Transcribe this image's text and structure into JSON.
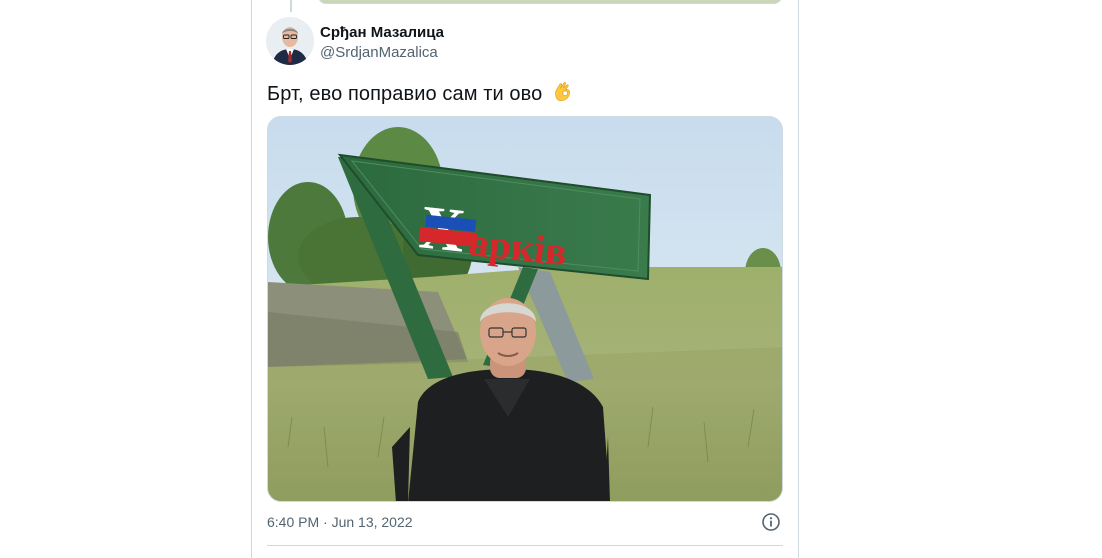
{
  "tweet": {
    "author_name": "Срђан Мазалица",
    "author_handle": "@SrdjanMazalica",
    "text": "Брт, ево поправио сам ти ово",
    "emoji": "👌",
    "timestamp": "6:40 PM · Jun 13, 2022",
    "media": {
      "sign_text": "Харків"
    }
  },
  "icons": {
    "info": "info-circle-icon",
    "emoji": "ok-hand-icon"
  },
  "colors": {
    "border": "#cfd9de",
    "text_primary": "#0f1419",
    "text_secondary": "#536471",
    "sign_green": "#2f6b3f"
  }
}
